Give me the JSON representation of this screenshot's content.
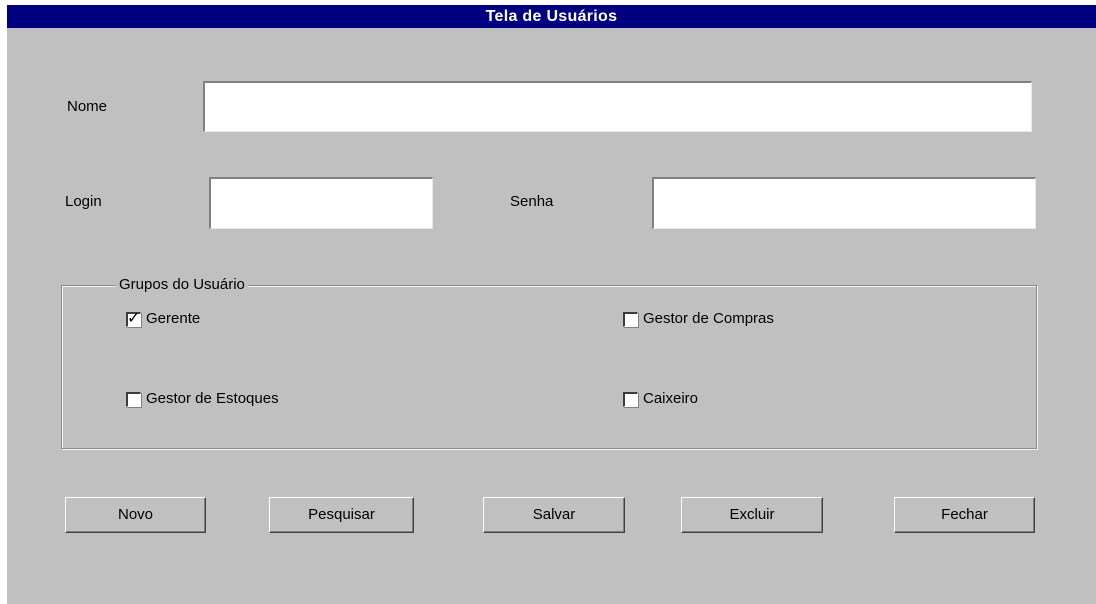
{
  "window": {
    "title": "Tela de Usuários"
  },
  "form": {
    "nome_label": "Nome",
    "nome_value": "",
    "login_label": "Login",
    "login_value": "",
    "senha_label": "Senha",
    "senha_value": ""
  },
  "groups": {
    "title": "Grupos do Usuário",
    "items": [
      {
        "label": "Gerente",
        "checked": true
      },
      {
        "label": "Gestor de Compras",
        "checked": false
      },
      {
        "label": "Gestor de Estoques",
        "checked": false
      },
      {
        "label": "Caixeiro",
        "checked": false
      }
    ]
  },
  "buttons": {
    "novo": "Novo",
    "pesquisar": "Pesquisar",
    "salvar": "Salvar",
    "excluir": "Excluir",
    "fechar": "Fechar"
  },
  "colors": {
    "title_bar": "#000080",
    "window_bg": "#c0c0c0"
  }
}
